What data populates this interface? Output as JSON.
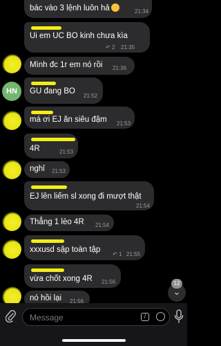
{
  "messages": [
    {
      "text": "bác vào 3 lệnh luôn hả",
      "emoji": "grinning-sweat-face",
      "time": "21:34"
    },
    {
      "text": "Ui em UC BO kinh chưa kìa",
      "reply_count": "2",
      "time": "21:35"
    },
    {
      "text": "Mình đc 1r em nó rồi",
      "time": "21:36"
    },
    {
      "avatar_initials": "HN",
      "text": "GU đang BO",
      "time": "21:52"
    },
    {
      "text": "má ơi EJ ăn siêu đậm",
      "time": "21:53"
    },
    {
      "text": "4R",
      "time": "21:53"
    },
    {
      "text": "nghỉ",
      "time": "21:53"
    },
    {
      "text": "EJ lên liếm sl xong đi mượt thật",
      "time": "21:54"
    },
    {
      "text": "Thẳng 1 lèo 4R",
      "time": "21:54"
    },
    {
      "text": "xxxusd sập toàn tập",
      "reply_count": "1",
      "time": "21:55"
    },
    {
      "text": "vừa chốt xong 4R",
      "time": "21:56"
    },
    {
      "text": "nó hồi lại",
      "time": "21:56"
    }
  ],
  "scroll_down_badge": "12",
  "composer": {
    "placeholder": "Message"
  },
  "colors": {
    "background": "#000000",
    "bubble": "#2c2c2e",
    "name_highlight": "#f3ee17",
    "avatar_hn": "#74b56f"
  }
}
